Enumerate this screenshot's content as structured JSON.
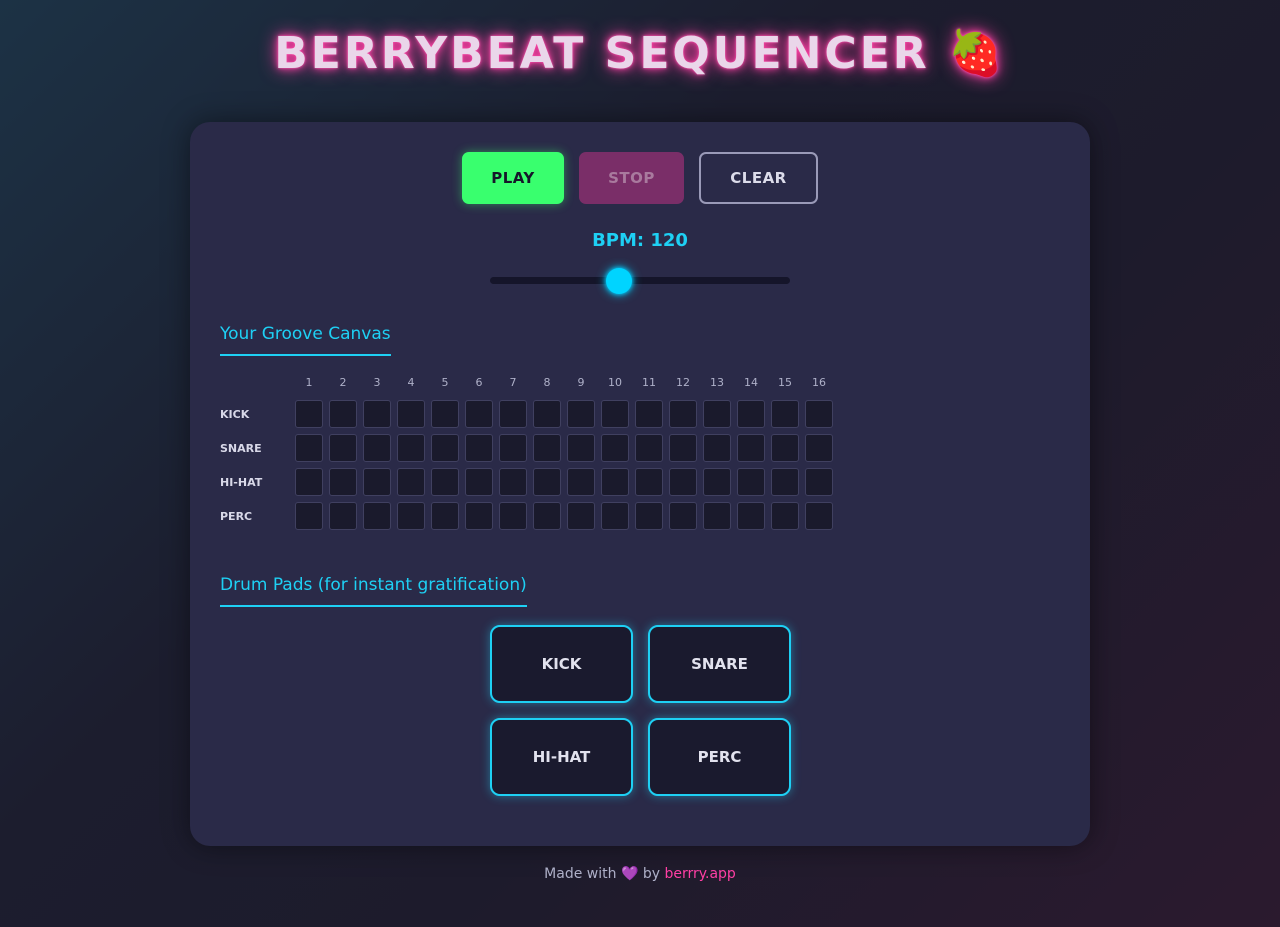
{
  "title": "BERRYBEAT SEQUENCER 🍓",
  "controls": {
    "play_label": "PLAY",
    "stop_label": "STOP",
    "clear_label": "CLEAR"
  },
  "bpm": {
    "label": "BPM: 120",
    "value": 120,
    "min": 60,
    "max": 200
  },
  "sequencer": {
    "title": "Your Groove Canvas",
    "steps": [
      "1",
      "2",
      "3",
      "4",
      "5",
      "6",
      "7",
      "8",
      "9",
      "10",
      "11",
      "12",
      "13",
      "14",
      "15",
      "16"
    ],
    "tracks": [
      {
        "label": "KICK",
        "pattern": [
          0,
          0,
          0,
          0,
          0,
          0,
          0,
          0,
          0,
          0,
          0,
          0,
          0,
          0,
          0,
          0
        ]
      },
      {
        "label": "SNARE",
        "pattern": [
          0,
          0,
          0,
          0,
          0,
          0,
          0,
          0,
          0,
          0,
          0,
          0,
          0,
          0,
          0,
          0
        ]
      },
      {
        "label": "HI-HAT",
        "pattern": [
          0,
          0,
          0,
          0,
          0,
          0,
          0,
          0,
          0,
          0,
          0,
          0,
          0,
          0,
          0,
          0
        ]
      },
      {
        "label": "PERC",
        "pattern": [
          0,
          0,
          0,
          0,
          0,
          0,
          0,
          0,
          0,
          0,
          0,
          0,
          0,
          0,
          0,
          0
        ]
      }
    ]
  },
  "pads": {
    "title": "Drum Pads (for instant gratification)",
    "items": [
      "KICK",
      "SNARE",
      "HI-HAT",
      "PERC"
    ]
  },
  "footer": {
    "prefix": "Made with",
    "heart": "💜",
    "by": "by",
    "link": "berrry.app"
  },
  "colors": {
    "accent": "#1ed0f4",
    "play": "#39ff6e",
    "stop": "#7a2e68",
    "brand_pink": "#ff3fa4"
  }
}
